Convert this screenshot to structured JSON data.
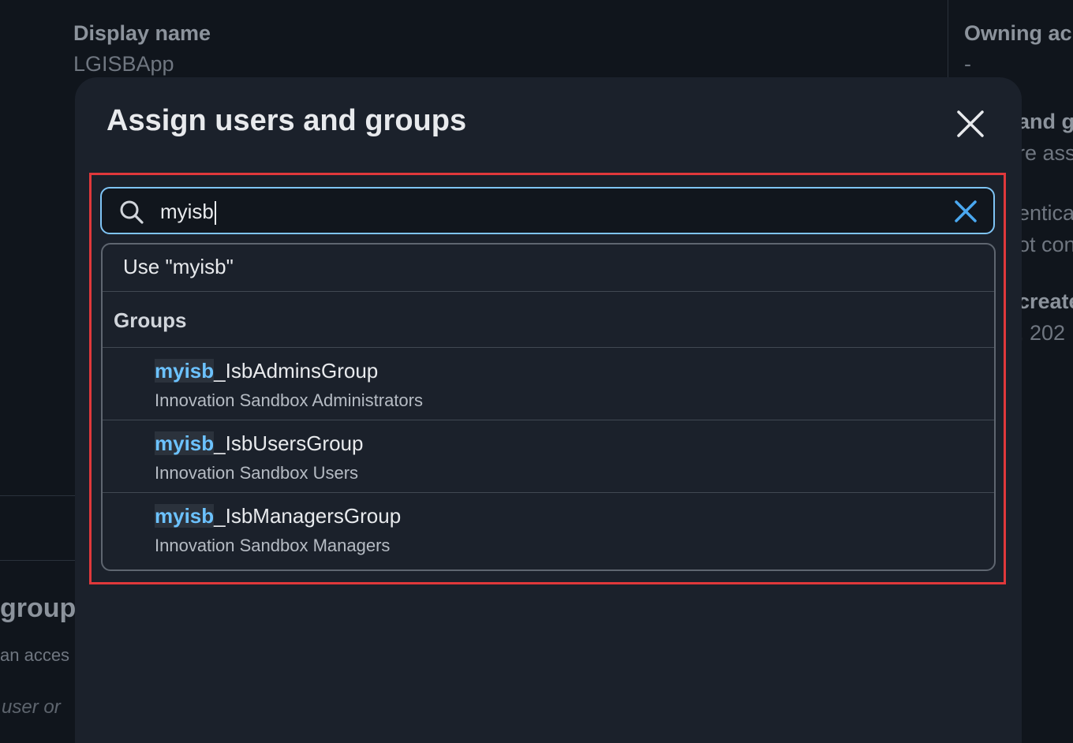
{
  "background": {
    "display_name_label": "Display name",
    "display_name_value": "LGISBApp",
    "owning_account_label": "Owning ac",
    "owning_account_value": "-",
    "right_frag_1": "and g",
    "right_frag_2": "re ass",
    "right_frag_3": "entica",
    "right_frag_4": "ot con",
    "right_frag_5": "create",
    "right_frag_6": ", 202",
    "left_heading_frag": "group",
    "left_sub_frag": "an acces",
    "left_placeholder_frag": "user or"
  },
  "modal": {
    "title": "Assign users and groups",
    "search": {
      "value": "myisb"
    },
    "dropdown": {
      "use_option": "Use \"myisb\"",
      "group_header": "Groups",
      "options": [
        {
          "match": "myisb",
          "rest": "_IsbAdminsGroup",
          "description": "Innovation Sandbox Administrators"
        },
        {
          "match": "myisb",
          "rest": "_IsbUsersGroup",
          "description": "Innovation Sandbox Users"
        },
        {
          "match": "myisb",
          "rest": "_IsbManagersGroup",
          "description": "Innovation Sandbox Managers"
        }
      ]
    }
  },
  "colors": {
    "accent": "#7fc4f5",
    "highlight_match": "#6cc2ff",
    "annotation_frame": "#e0383b",
    "modal_bg": "#1b212b"
  },
  "icons": [
    "search-icon",
    "close-icon",
    "clear-icon"
  ]
}
